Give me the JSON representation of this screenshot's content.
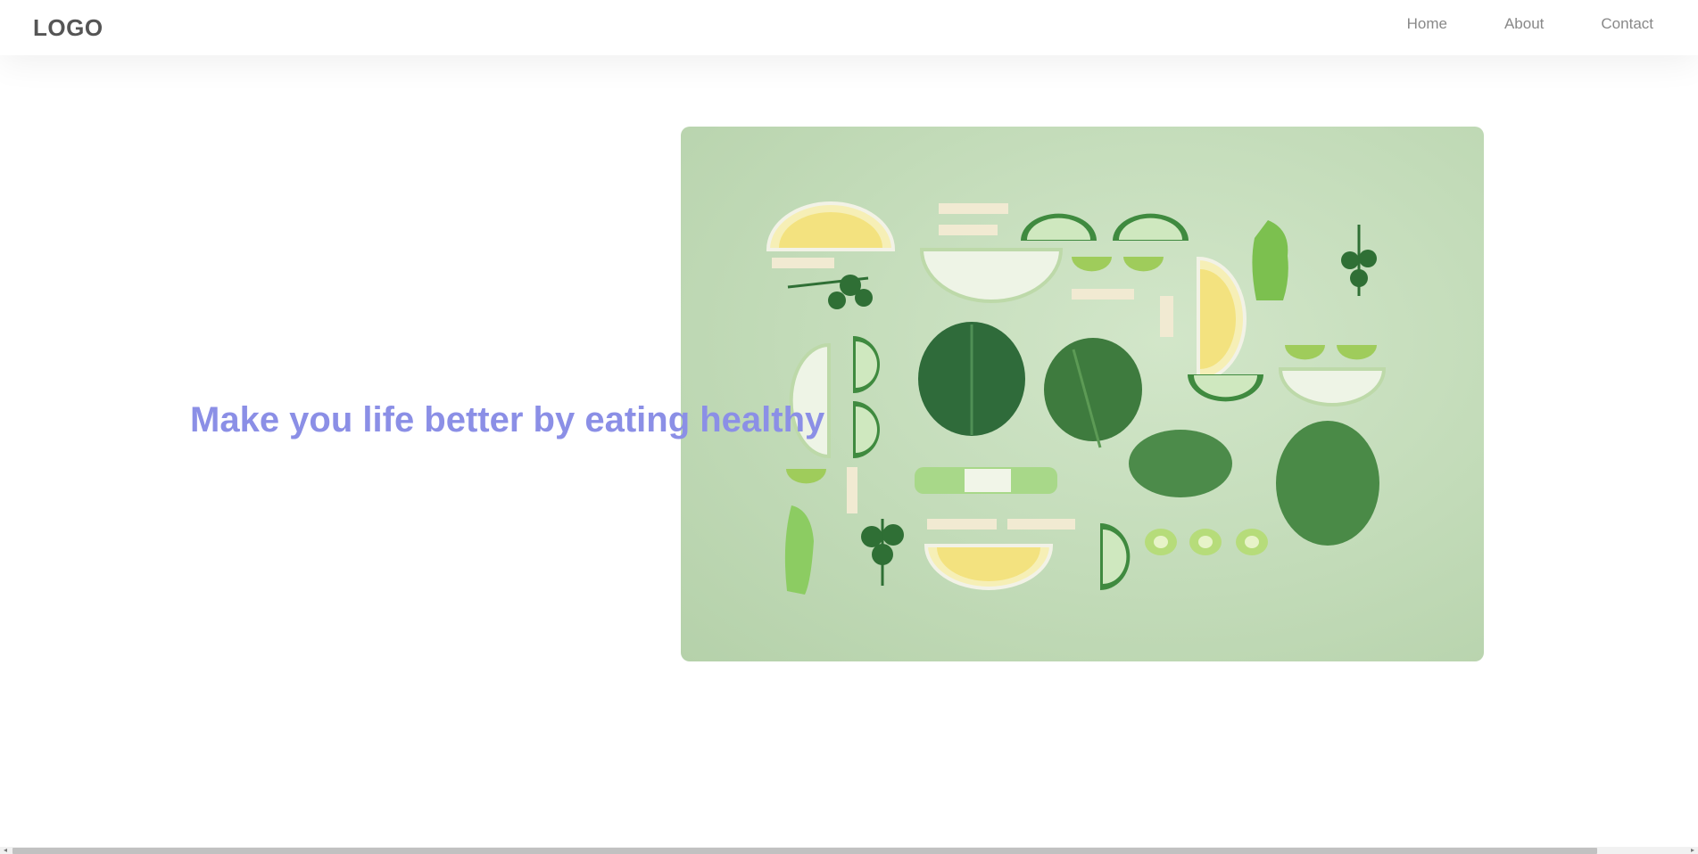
{
  "header": {
    "logo_text": "LOGO",
    "nav": [
      {
        "label": "Home"
      },
      {
        "label": "About"
      },
      {
        "label": "Contact"
      }
    ]
  },
  "hero": {
    "title": "Make you life better by eating healthy",
    "image": {
      "subject": "flat-lay of sliced green vegetables, lemon and herbs on a pale green background",
      "background_color": "#c4dcb9"
    },
    "title_color": "#8b8fe6"
  },
  "scrollbar": {
    "left_arrow": "◂",
    "right_arrow": "▸"
  }
}
